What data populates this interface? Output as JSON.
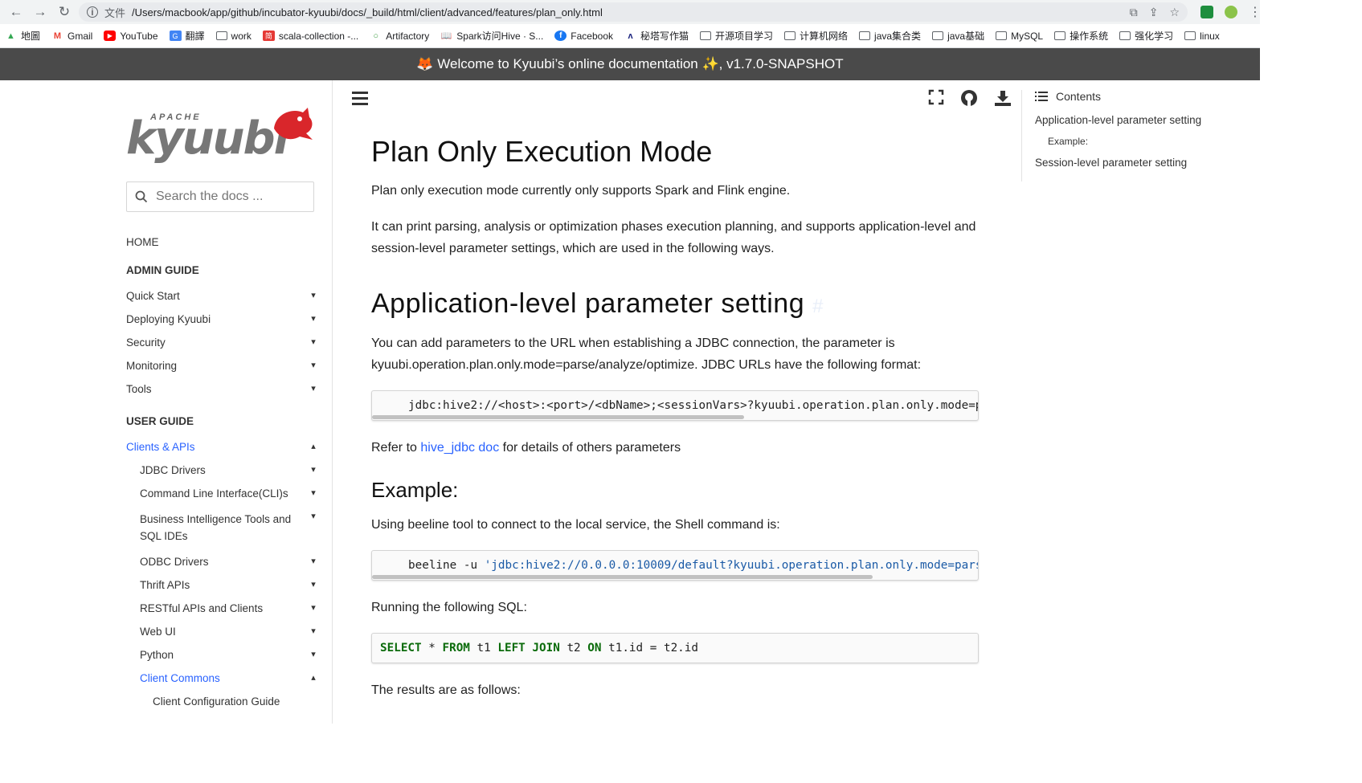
{
  "browser": {
    "url_label": "文件",
    "url": "/Users/macbook/app/github/incubator-kyuubi/docs/_build/html/client/advanced/features/plan_only.html",
    "bookmarks": [
      {
        "label": "地圖",
        "icon": "maps-icon"
      },
      {
        "label": "Gmail",
        "icon": "gmail-icon"
      },
      {
        "label": "YouTube",
        "icon": "youtube-icon"
      },
      {
        "label": "翻譯",
        "icon": "translate-icon"
      },
      {
        "label": "work",
        "icon": "folder-icon"
      },
      {
        "label": "scala-collection -...",
        "icon": "bookmark-icon"
      },
      {
        "label": "Artifactory",
        "icon": "artifactory-icon"
      },
      {
        "label": "Spark访问Hive · S...",
        "icon": "book-icon"
      },
      {
        "label": "Facebook",
        "icon": "facebook-icon"
      },
      {
        "label": "秘塔写作猫",
        "icon": "metaso-icon"
      },
      {
        "label": "开源项目学习",
        "icon": "folder-icon"
      },
      {
        "label": "计算机网络",
        "icon": "folder-icon"
      },
      {
        "label": "java集合类",
        "icon": "folder-icon"
      },
      {
        "label": "java基础",
        "icon": "folder-icon"
      },
      {
        "label": "MySQL",
        "icon": "folder-icon"
      },
      {
        "label": "操作系统",
        "icon": "folder-icon"
      },
      {
        "label": "强化学习",
        "icon": "folder-icon"
      },
      {
        "label": "linux",
        "icon": "folder-icon"
      }
    ]
  },
  "announcement": "🦊 Welcome to Kyuubi’s online documentation ✨, v1.7.0-SNAPSHOT",
  "sidebar": {
    "logo_top": "APACHE",
    "logo_word": "kyuubi",
    "search_placeholder": "Search the docs ...",
    "home": "HOME",
    "admin_caption": "ADMIN GUIDE",
    "admin_items": [
      "Quick Start",
      "Deploying Kyuubi",
      "Security",
      "Monitoring",
      "Tools"
    ],
    "user_caption": "USER GUIDE",
    "clients_label": "Clients & APIs",
    "client_items": [
      "JDBC Drivers",
      "Command Line Interface(CLI)s",
      "Business Intelligence Tools and SQL IDEs",
      "ODBC Drivers",
      "Thrift APIs",
      "RESTful APIs and Clients",
      "Web UI",
      "Python"
    ],
    "client_commons": "Client Commons",
    "client_config": "Client Configuration Guide"
  },
  "main": {
    "title": "Plan Only Execution Mode",
    "intro1": "Plan only execution mode currently only supports Spark and Flink engine.",
    "intro2": "It can print parsing, analysis or optimization phases execution planning, and supports application-level and session-level parameter settings, which are used in the following ways.",
    "app_heading": "Application-level parameter setting",
    "anchor": "#",
    "app_para": "You can add parameters to the URL when establishing a JDBC connection, the parameter is kyuubi.operation.plan.only.mode=parse/analyze/optimize. JDBC URLs have the following format:",
    "jdbc_code": "jdbc:hive2://<host>:<port>/<dbName>;<sessionVars>?kyuubi.operation.plan.only.mode=p",
    "refer_before": "Refer to ",
    "refer_link": "hive_jdbc doc",
    "refer_after": " for details of others parameters",
    "example_heading": "Example:",
    "beeline_para": "Using beeline tool to connect to the local service, the Shell command is:",
    "beeline_cmd": "beeline -u ",
    "beeline_str": "'jdbc:hive2://0.0.0.0:10009/default?kyuubi.operation.plan.only.mode=pars",
    "sql_para": "Running the following SQL:",
    "sql": {
      "kw_select": "SELECT",
      "star": " * ",
      "kw_from": "FROM",
      "t1": " t1 ",
      "kw_left": "LEFT",
      "sp": " ",
      "kw_join": "JOIN",
      "t2": " t2 ",
      "kw_on": "ON",
      "cond": " t1.id = t2.id"
    },
    "results_para": "The results are as follows:"
  },
  "toc": {
    "heading": "Contents",
    "items": [
      "Application-level parameter setting",
      "Example:",
      "Session-level parameter setting"
    ]
  },
  "colors": {
    "accent": "#2962ff",
    "announcement_bg": "#4a4a4a",
    "logo_red": "#d9262b"
  }
}
